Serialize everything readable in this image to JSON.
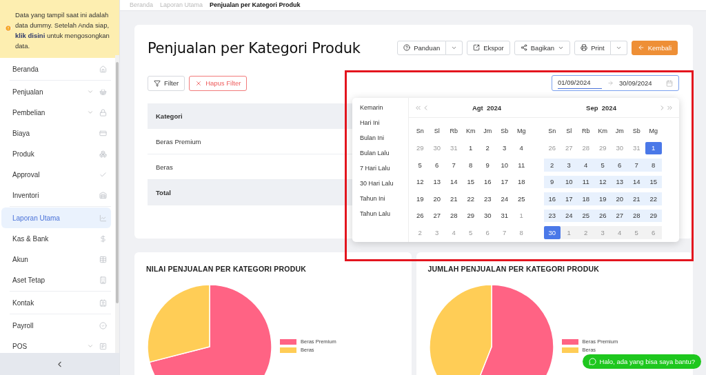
{
  "notice": {
    "text": "Data yang tampil saat ini adalah data dummy. Setelah Anda siap, **klik disini** untuk mengosongkan data."
  },
  "sidebar": {
    "sections": [
      [
        {
          "label": "Beranda",
          "expandable": false,
          "selected": false
        }
      ],
      [
        {
          "label": "Penjualan",
          "expandable": true,
          "selected": false
        },
        {
          "label": "Pembelian",
          "expandable": true,
          "selected": false
        },
        {
          "label": "Biaya",
          "expandable": false,
          "selected": false
        },
        {
          "label": "Produk",
          "expandable": false,
          "selected": false
        },
        {
          "label": "Approval",
          "expandable": false,
          "selected": false
        },
        {
          "label": "Inventori",
          "expandable": false,
          "selected": false
        }
      ],
      [
        {
          "label": "Laporan Utama",
          "expandable": false,
          "selected": true
        },
        {
          "label": "Kas & Bank",
          "expandable": false,
          "selected": false
        },
        {
          "label": "Akun",
          "expandable": false,
          "selected": false
        },
        {
          "label": "Aset Tetap",
          "expandable": false,
          "selected": false
        }
      ],
      [
        {
          "label": "Kontak",
          "expandable": false,
          "selected": false
        }
      ],
      [
        {
          "label": "Payroll",
          "expandable": false,
          "selected": false
        },
        {
          "label": "POS",
          "expandable": true,
          "selected": false
        }
      ]
    ]
  },
  "breadcrumb": [
    "Beranda",
    "Laporan Utama",
    "Penjualan per Kategori Produk"
  ],
  "page_title": "Penjualan per Kategori Produk",
  "toolbar": [
    {
      "label": "Panduan",
      "kind": "split"
    },
    {
      "label": "Ekspor",
      "kind": "plain"
    },
    {
      "label": "Bagikan",
      "kind": "dropdown"
    },
    {
      "label": "Print",
      "kind": "split"
    },
    {
      "label": "Kembali",
      "kind": "primary"
    }
  ],
  "filters": [
    {
      "label": "Filter",
      "kind": "plain"
    },
    {
      "label": "Hapus Filter",
      "kind": "danger"
    }
  ],
  "date_range": {
    "start": "01/09/2024",
    "end": "30/09/2024"
  },
  "table": {
    "columns": [
      "Kategori"
    ],
    "rows": [
      {
        "cells": [
          "Beras Premium"
        ],
        "kind": "row"
      },
      {
        "cells": [
          "Beras"
        ],
        "kind": "row"
      },
      {
        "cells": [
          "Total"
        ],
        "kind": "total"
      }
    ]
  },
  "date_picker": {
    "presets": [
      "Kemarin",
      "Hari Ini",
      "Bulan Ini",
      "Bulan Lalu",
      "7 Hari Lalu",
      "30 Hari Lalu",
      "Tahun Ini",
      "Tahun Lalu"
    ],
    "months": [
      {
        "month": "Agt",
        "year": "2024",
        "weekdays": [
          "Sn",
          "Sl",
          "Rb",
          "Km",
          "Jm",
          "Sb",
          "Mg"
        ],
        "weeks": [
          [
            {
              "d": "29",
              "kind": "outside"
            },
            {
              "d": "30",
              "kind": "outside"
            },
            {
              "d": "31",
              "kind": "outside"
            },
            {
              "d": "1",
              "kind": "day"
            },
            {
              "d": "2",
              "kind": "day"
            },
            {
              "d": "3",
              "kind": "day"
            },
            {
              "d": "4",
              "kind": "day"
            }
          ],
          [
            {
              "d": "5",
              "kind": "day"
            },
            {
              "d": "6",
              "kind": "day"
            },
            {
              "d": "7",
              "kind": "day"
            },
            {
              "d": "8",
              "kind": "day"
            },
            {
              "d": "9",
              "kind": "day"
            },
            {
              "d": "10",
              "kind": "day"
            },
            {
              "d": "11",
              "kind": "day"
            }
          ],
          [
            {
              "d": "12",
              "kind": "day"
            },
            {
              "d": "13",
              "kind": "day"
            },
            {
              "d": "14",
              "kind": "day"
            },
            {
              "d": "15",
              "kind": "day"
            },
            {
              "d": "16",
              "kind": "day"
            },
            {
              "d": "17",
              "kind": "day"
            },
            {
              "d": "18",
              "kind": "day"
            }
          ],
          [
            {
              "d": "19",
              "kind": "day"
            },
            {
              "d": "20",
              "kind": "day"
            },
            {
              "d": "21",
              "kind": "day"
            },
            {
              "d": "22",
              "kind": "day"
            },
            {
              "d": "23",
              "kind": "day"
            },
            {
              "d": "24",
              "kind": "day"
            },
            {
              "d": "25",
              "kind": "day"
            }
          ],
          [
            {
              "d": "26",
              "kind": "day"
            },
            {
              "d": "27",
              "kind": "day"
            },
            {
              "d": "28",
              "kind": "day"
            },
            {
              "d": "29",
              "kind": "day"
            },
            {
              "d": "30",
              "kind": "day"
            },
            {
              "d": "31",
              "kind": "day"
            },
            {
              "d": "1",
              "kind": "outside"
            }
          ],
          [
            {
              "d": "2",
              "kind": "outside"
            },
            {
              "d": "3",
              "kind": "outside"
            },
            {
              "d": "4",
              "kind": "outside"
            },
            {
              "d": "5",
              "kind": "outside"
            },
            {
              "d": "6",
              "kind": "outside"
            },
            {
              "d": "7",
              "kind": "outside"
            },
            {
              "d": "8",
              "kind": "outside"
            }
          ]
        ]
      },
      {
        "month": "Sep",
        "year": "2024",
        "weekdays": [
          "Sn",
          "Sl",
          "Rb",
          "Km",
          "Jm",
          "Sb",
          "Mg"
        ],
        "weeks": [
          [
            {
              "d": "26",
              "kind": "outside"
            },
            {
              "d": "27",
              "kind": "outside"
            },
            {
              "d": "28",
              "kind": "outside"
            },
            {
              "d": "29",
              "kind": "outside"
            },
            {
              "d": "30",
              "kind": "outside"
            },
            {
              "d": "31",
              "kind": "outside"
            },
            {
              "d": "1",
              "kind": "range_start"
            }
          ],
          [
            {
              "d": "2",
              "kind": "in_range"
            },
            {
              "d": "3",
              "kind": "in_range"
            },
            {
              "d": "4",
              "kind": "in_range"
            },
            {
              "d": "5",
              "kind": "in_range"
            },
            {
              "d": "6",
              "kind": "in_range"
            },
            {
              "d": "7",
              "kind": "in_range"
            },
            {
              "d": "8",
              "kind": "in_range"
            }
          ],
          [
            {
              "d": "9",
              "kind": "in_range"
            },
            {
              "d": "10",
              "kind": "in_range"
            },
            {
              "d": "11",
              "kind": "in_range"
            },
            {
              "d": "12",
              "kind": "in_range"
            },
            {
              "d": "13",
              "kind": "in_range"
            },
            {
              "d": "14",
              "kind": "in_range"
            },
            {
              "d": "15",
              "kind": "in_range"
            }
          ],
          [
            {
              "d": "16",
              "kind": "in_range"
            },
            {
              "d": "17",
              "kind": "in_range"
            },
            {
              "d": "18",
              "kind": "in_range"
            },
            {
              "d": "19",
              "kind": "in_range"
            },
            {
              "d": "20",
              "kind": "in_range"
            },
            {
              "d": "21",
              "kind": "in_range"
            },
            {
              "d": "22",
              "kind": "in_range"
            }
          ],
          [
            {
              "d": "23",
              "kind": "in_range"
            },
            {
              "d": "24",
              "kind": "in_range"
            },
            {
              "d": "25",
              "kind": "in_range"
            },
            {
              "d": "26",
              "kind": "in_range"
            },
            {
              "d": "27",
              "kind": "in_range"
            },
            {
              "d": "28",
              "kind": "in_range"
            },
            {
              "d": "29",
              "kind": "in_range"
            }
          ],
          [
            {
              "d": "30",
              "kind": "range_end"
            },
            {
              "d": "1",
              "kind": "hover_outside"
            },
            {
              "d": "2",
              "kind": "hover_outside"
            },
            {
              "d": "3",
              "kind": "hover_outside"
            },
            {
              "d": "4",
              "kind": "hover_outside"
            },
            {
              "d": "5",
              "kind": "hover_outside"
            },
            {
              "d": "6",
              "kind": "hover_outside"
            }
          ]
        ]
      }
    ]
  },
  "charts": [
    {
      "title": "NILAI PENJUALAN PER KATEGORI PRODUK",
      "legend": [
        {
          "label": "Beras Premium",
          "color": "#ff6384"
        },
        {
          "label": "Beras",
          "color": "#ffcd56"
        }
      ]
    },
    {
      "title": "JUMLAH PENJUALAN PER KATEGORI PRODUK",
      "legend": [
        {
          "label": "Beras Premium",
          "color": "#ff6384"
        },
        {
          "label": "Beras",
          "color": "#ffcd56"
        }
      ]
    }
  ],
  "chat_button": {
    "label": "Halo, ada yang bisa saya bantu?"
  }
}
